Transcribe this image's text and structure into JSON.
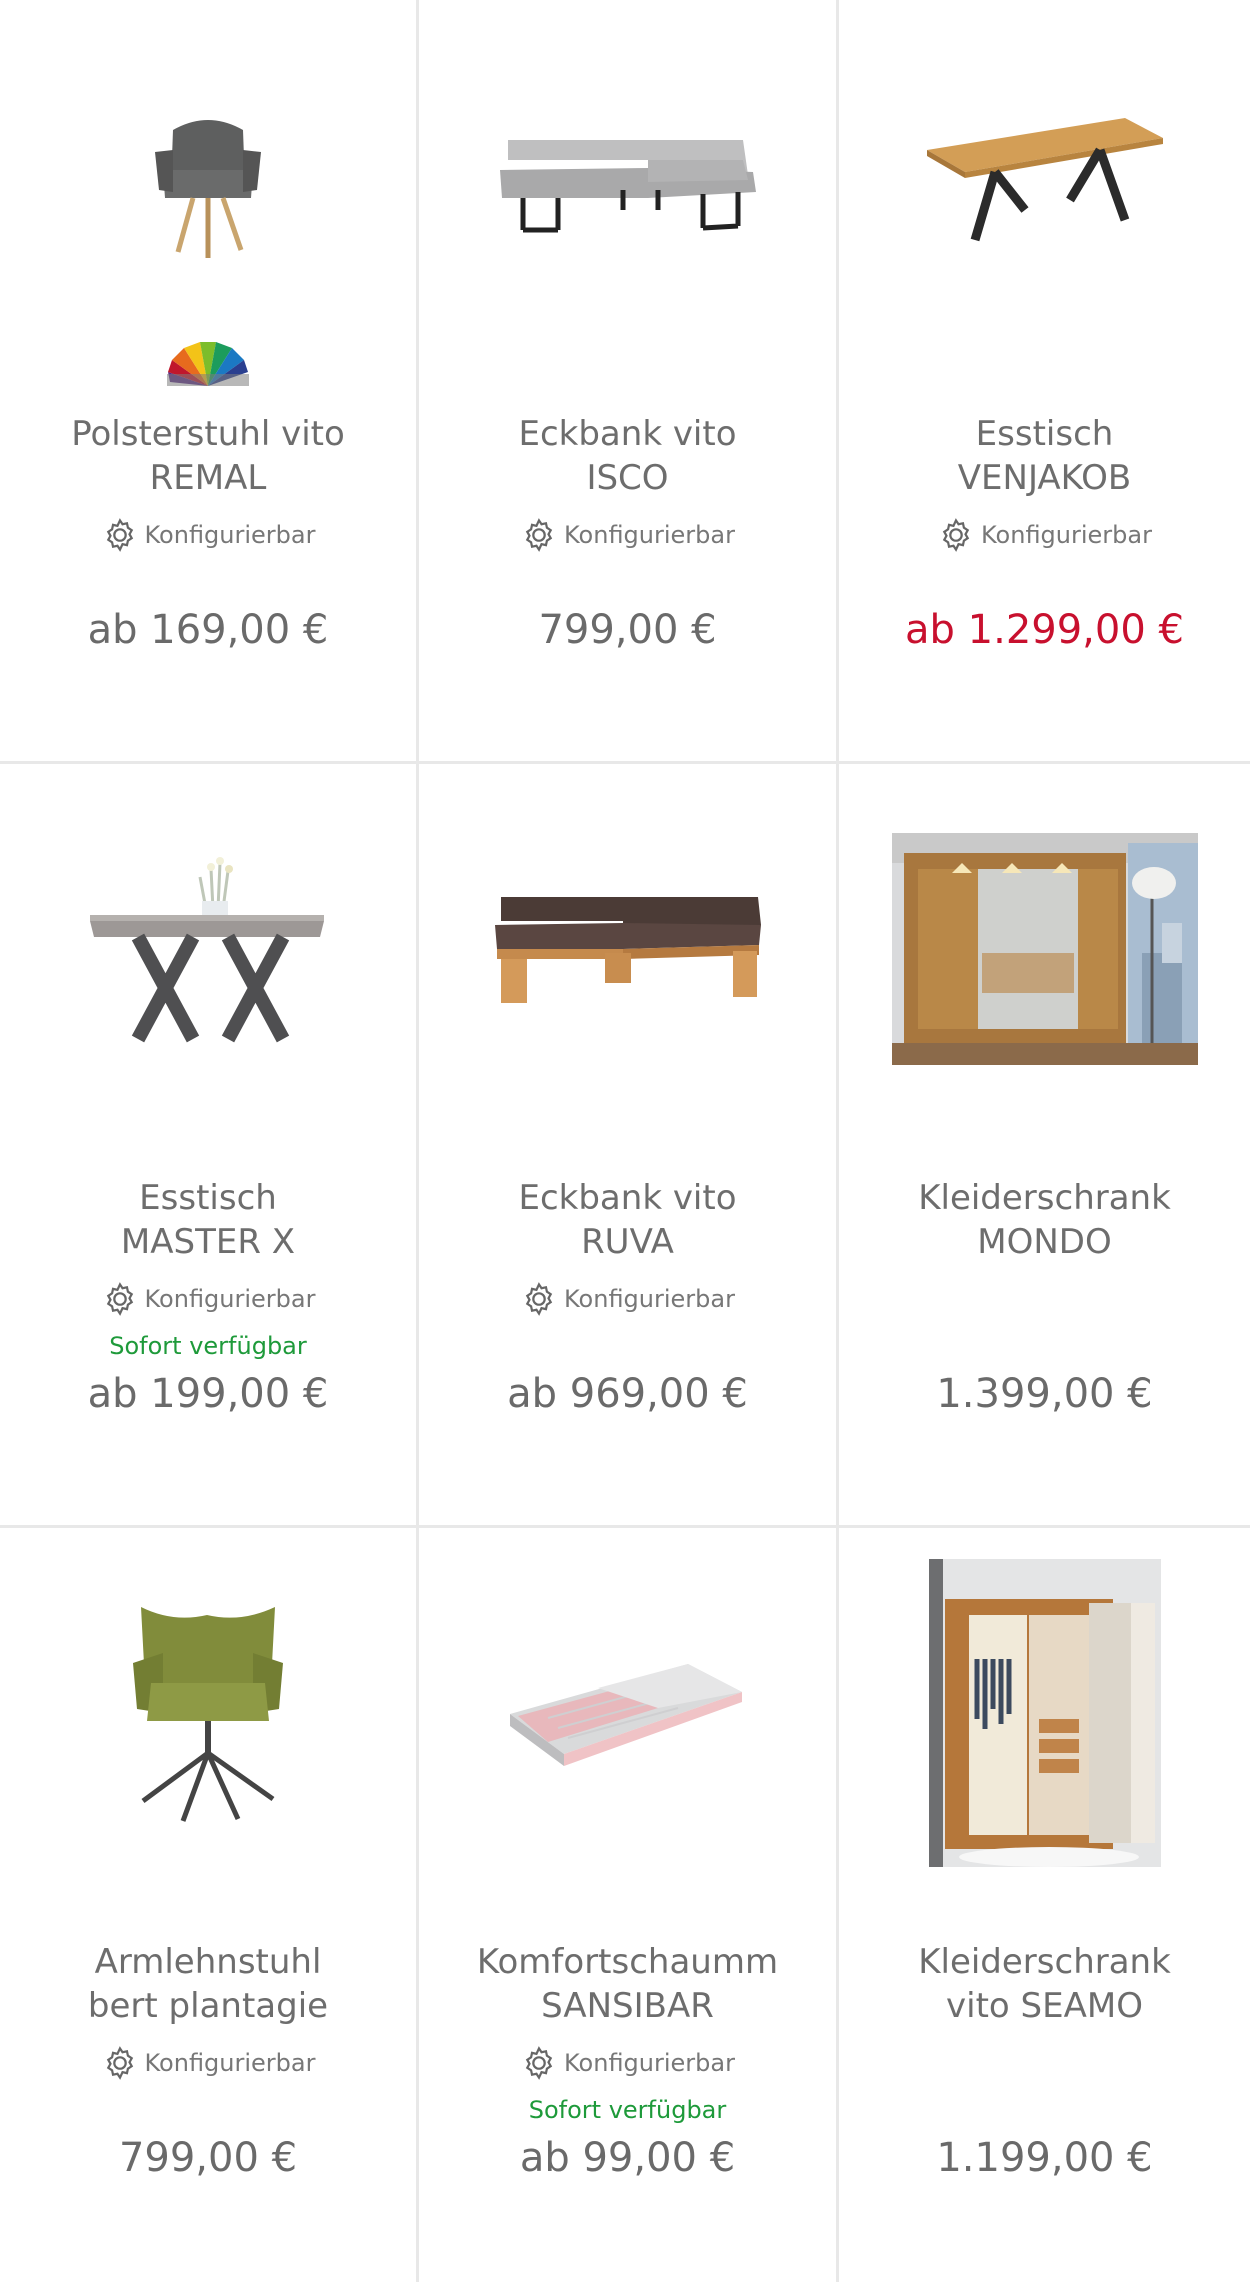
{
  "products": [
    {
      "title": "Polsterstuhl vito\nREMAL",
      "config": "Konfigurierbar",
      "availability": "",
      "price": "ab 169,00 €",
      "price_sale": false,
      "image": "chair-grey",
      "swatch": true
    },
    {
      "title": "Eckbank vito\nISCO",
      "config": "Konfigurierbar",
      "availability": "",
      "price": "799,00 €",
      "price_sale": false,
      "image": "corner-bench-grey",
      "swatch": false
    },
    {
      "title": "Esstisch\nVENJAKOB",
      "config": "Konfigurierbar",
      "availability": "",
      "price": "ab 1.299,00 €",
      "price_sale": true,
      "image": "table-oak",
      "swatch": false
    },
    {
      "title": "Esstisch\nMASTER X",
      "config": "Konfigurierbar",
      "availability": "Sofort verfügbar",
      "price": "ab 199,00 €",
      "price_sale": false,
      "image": "table-x",
      "swatch": false
    },
    {
      "title": "Eckbank vito\nRUVA",
      "config": "Konfigurierbar",
      "availability": "",
      "price": "ab 969,00 €",
      "price_sale": false,
      "image": "corner-bench-brown",
      "swatch": false
    },
    {
      "title": "Kleiderschrank\nMONDO",
      "config": "",
      "availability": "",
      "price": "1.399,00 €",
      "price_sale": false,
      "image": "wardrobe-room",
      "swatch": false
    },
    {
      "title": "Armlehnstuhl\nbert plantagie",
      "config": "Konfigurierbar",
      "availability": "",
      "price": "799,00 €",
      "price_sale": false,
      "image": "chair-olive",
      "swatch": false
    },
    {
      "title": "Komfortschaumm\nSANSIBAR",
      "config": "Konfigurierbar",
      "availability": "Sofort verfügbar",
      "price": "ab 99,00 €",
      "price_sale": false,
      "image": "mattress",
      "swatch": false
    },
    {
      "title": "Kleiderschrank\nvito SEAMO",
      "config": "",
      "availability": "",
      "price": "1.199,00 €",
      "price_sale": false,
      "image": "wardrobe-open",
      "swatch": false
    }
  ],
  "colors": {
    "text": "#6d6d6d",
    "sale": "#c8102e",
    "available": "#1e9a3a",
    "divider": "#e8e8e8"
  }
}
